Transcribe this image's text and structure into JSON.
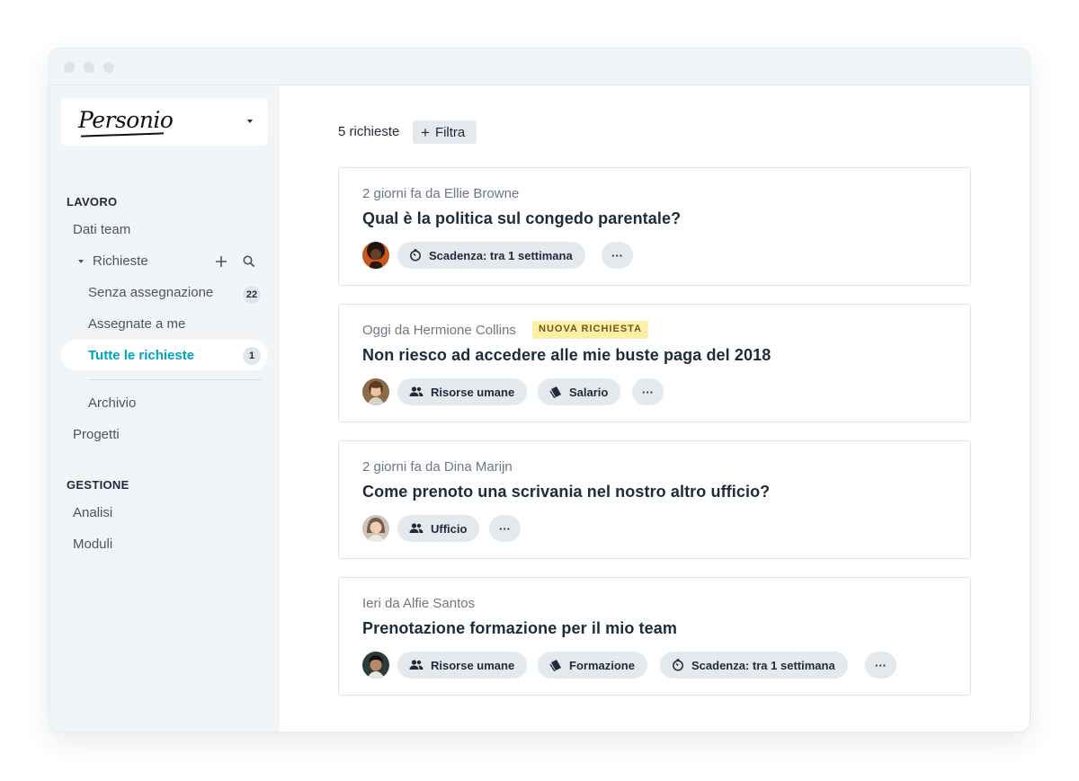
{
  "sidebar": {
    "logo_text": "Personio",
    "sections": [
      {
        "heading": "LAVORO"
      },
      {
        "heading": "GESTIONE"
      }
    ],
    "items": {
      "dati_team": "Dati team",
      "richieste": "Richieste",
      "senza_assegnazione": "Senza assegnazione",
      "senza_assegnazione_count": "22",
      "assegnate_a_me": "Assegnate a me",
      "tutte_le_richieste": "Tutte le richieste",
      "tutte_le_richieste_count": "1",
      "archivio": "Archivio",
      "progetti": "Progetti",
      "analisi": "Analisi",
      "moduli": "Moduli"
    }
  },
  "main": {
    "request_count": "5 richieste",
    "filter_label": "Filtra",
    "requests": [
      {
        "meta": "2 giorni fa da Ellie Browne",
        "title": "Qual è la politica sul congedo parentale?",
        "tags": [
          "Scadenza: tra 1 settimana"
        ],
        "more": "···"
      },
      {
        "meta": "Oggi da Hermione Collins",
        "badge": "NUOVA RICHIESTA",
        "title": "Non riesco ad accedere alle mie buste paga del 2018",
        "tags": [
          "Risorse umane",
          "Salario"
        ],
        "more": "···"
      },
      {
        "meta": "2 giorni fa da Dina Marijn",
        "title": "Come prenoto una scrivania nel nostro altro ufficio?",
        "tags": [
          "Ufficio"
        ],
        "more": "···"
      },
      {
        "meta": "Ieri da Alfie Santos",
        "title": "Prenotazione formazione per il mio team",
        "tags": [
          "Risorse umane",
          "Formazione",
          "Scadenza: tra 1 settimana"
        ],
        "more": "···"
      }
    ]
  },
  "colors": {
    "accent": "#00a3c4",
    "sidebar_bg": "#f2f5f7",
    "tag_bg": "#e4e9ee",
    "badge_bg": "#fdf0a6"
  }
}
